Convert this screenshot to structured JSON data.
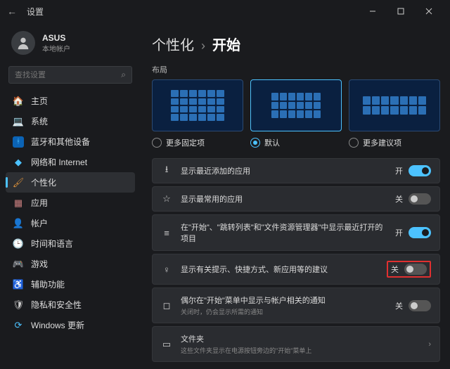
{
  "titlebar": {
    "app_title": "设置"
  },
  "account": {
    "name": "ASUS",
    "subtitle": "本地帐户"
  },
  "search": {
    "placeholder": "查找设置"
  },
  "sidebar": {
    "items": [
      {
        "icon": "home-icon",
        "glyph": "🏠",
        "color": "#4cc2ff",
        "label": "主页"
      },
      {
        "icon": "system-icon",
        "glyph": "💻",
        "color": "#cccccc",
        "label": "系统"
      },
      {
        "icon": "bluetooth-icon",
        "glyph": "ᚼ",
        "color": "#4cc2ff",
        "bg": "#0b63b5",
        "label": "蓝牙和其他设备"
      },
      {
        "icon": "network-icon",
        "glyph": "◆",
        "color": "#4cc2ff",
        "label": "网络和 Internet"
      },
      {
        "icon": "personalize-icon",
        "glyph": "🖌",
        "color": "#d98f3a",
        "label": "个性化"
      },
      {
        "icon": "apps-icon",
        "glyph": "▦",
        "color": "#c97f7f",
        "label": "应用"
      },
      {
        "icon": "account-icon",
        "glyph": "👤",
        "color": "#cccccc",
        "label": "帐户"
      },
      {
        "icon": "time-icon",
        "glyph": "🕒",
        "color": "#cccccc",
        "label": "时间和语言"
      },
      {
        "icon": "gaming-icon",
        "glyph": "🎮",
        "color": "#cccccc",
        "label": "游戏"
      },
      {
        "icon": "accessibility-icon",
        "glyph": "♿",
        "color": "#5fa8d3",
        "label": "辅助功能"
      },
      {
        "icon": "privacy-icon",
        "glyph": "🛡",
        "color": "#cccccc",
        "label": "隐私和安全性"
      },
      {
        "icon": "update-icon",
        "glyph": "⟳",
        "color": "#4cc2ff",
        "label": "Windows 更新"
      }
    ],
    "selected_index": 4
  },
  "breadcrumb": {
    "parent": "个性化",
    "current": "开始"
  },
  "layout_section": {
    "heading": "布局",
    "options": [
      {
        "label": "更多固定项",
        "selected": false
      },
      {
        "label": "默认",
        "selected": true
      },
      {
        "label": "更多建议项",
        "selected": false
      }
    ]
  },
  "settings_rows": [
    {
      "icon": "download-icon",
      "glyph": "⭳",
      "title": "显示最近添加的应用",
      "toggle_state": "开",
      "on": true
    },
    {
      "icon": "star-icon",
      "glyph": "☆",
      "title": "显示最常用的应用",
      "toggle_state": "关",
      "on": false
    },
    {
      "icon": "list-icon",
      "glyph": "≡",
      "title": "在\"开始\"、\"跳转列表\"和\"文件资源管理器\"中显示最近打开的项目",
      "toggle_state": "开",
      "on": true
    },
    {
      "icon": "bulb-icon",
      "glyph": "♀",
      "title": "显示有关提示、快捷方式、新应用等的建议",
      "toggle_state": "关",
      "on": false,
      "highlight": true
    },
    {
      "icon": "bell-icon",
      "glyph": "◻",
      "title": "偶尔在\"开始\"菜单中显示与帐户相关的通知",
      "subtitle": "关闭时，仍会显示所需的通知",
      "toggle_state": "关",
      "on": false
    },
    {
      "icon": "folder-icon",
      "glyph": "▭",
      "title": "文件夹",
      "subtitle": "这些文件夹显示在电源按钮旁边的\"开始\"菜单上",
      "expandable": true
    }
  ]
}
